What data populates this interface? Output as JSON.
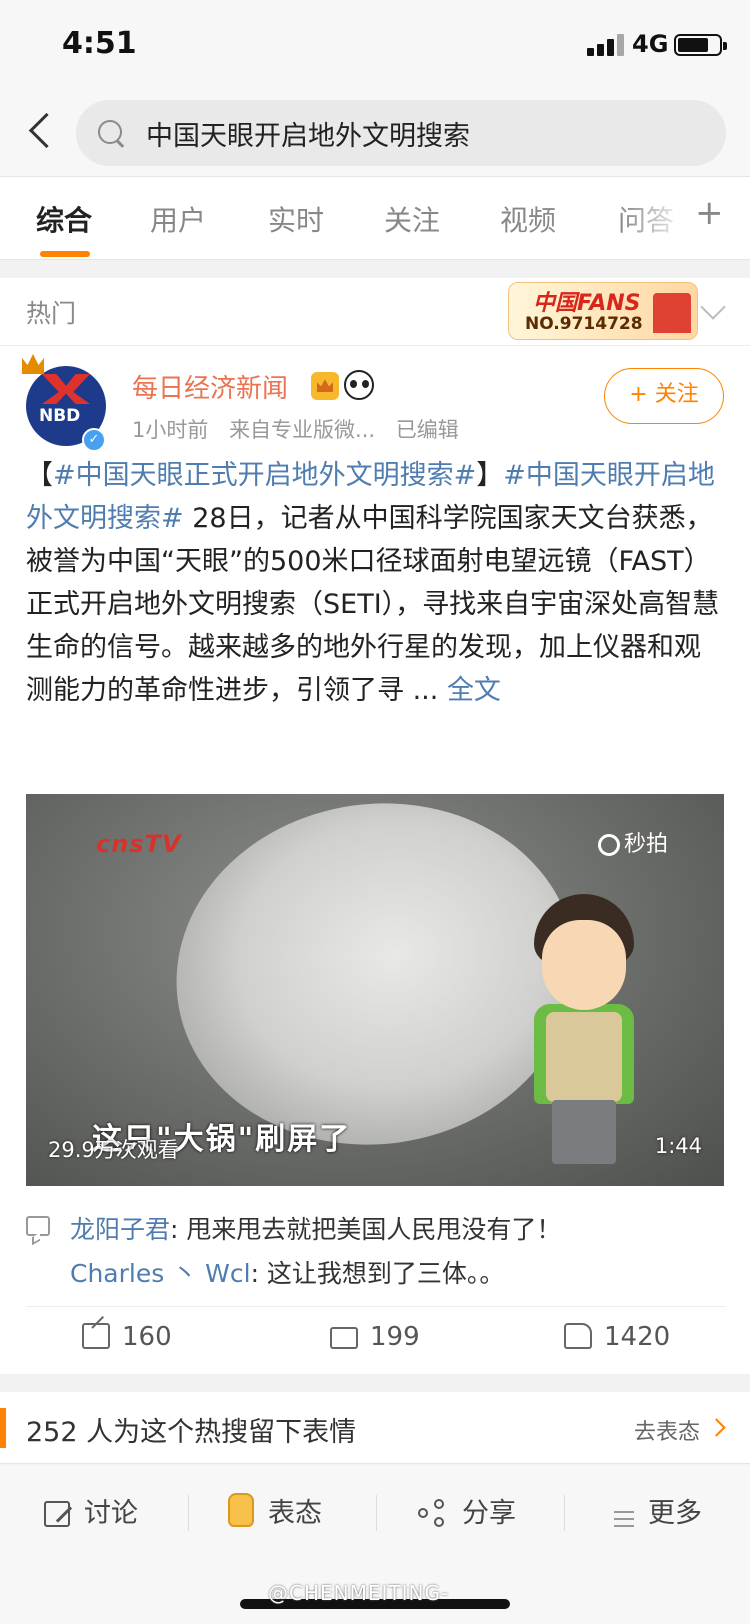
{
  "status": {
    "time": "4:51",
    "network": "4G"
  },
  "search": {
    "query": "中国天眼开启地外文明搜索"
  },
  "tabs": [
    {
      "label": "综合",
      "active": true
    },
    {
      "label": "用户"
    },
    {
      "label": "实时"
    },
    {
      "label": "关注"
    },
    {
      "label": "视频"
    },
    {
      "label": "问答"
    }
  ],
  "hot": {
    "label": "热门",
    "badge_title": "中国FANS",
    "badge_no": "NO.9714728"
  },
  "post": {
    "avatar_text": "NBD",
    "author": "每日经济新闻",
    "time": "1小时前",
    "source": "来自专业版微...",
    "edited": "已编辑",
    "follow_label": "+ 关注",
    "text_open": "【",
    "hashtag1": "#中国天眼正式开启地外文明搜索#",
    "text_close": "】",
    "hashtag2": "#中国天眼开启地外文明搜索#",
    "body": " 28日，记者从中国科学院国家天文台获悉，被誉为中国“天眼”的500米口径球面射电望远镜（FAST）正式开启地外文明搜索（SETI），寻找来自宇宙深处高智慧生命的信号。越来越多的地外行星的发现，加上仪器和观测能力的革命性进步，引领了寻 ...",
    "full_text_link": "全文",
    "video": {
      "channel_logo": "cnsTV",
      "platform": "秒拍",
      "caption": "这只\"大锅\"刷屏了",
      "views": "29.9万次观看",
      "duration": "1:44"
    },
    "comments": [
      {
        "user": "龙阳子君",
        "text": ": 甩来甩去就把美国人民甩没有了！"
      },
      {
        "user": "Charles 丶 Wcl",
        "text": ": 这让我想到了三体。。"
      }
    ],
    "stats": {
      "reposts": "160",
      "comments": "199",
      "likes": "1420"
    }
  },
  "emotion": {
    "text": "252 人为这个热搜留下表情",
    "link": "去表态"
  },
  "toolbar": {
    "discuss": "讨论",
    "react": "表态",
    "share": "分享",
    "more": "更多"
  },
  "watermark": "@CHENMEITING-"
}
